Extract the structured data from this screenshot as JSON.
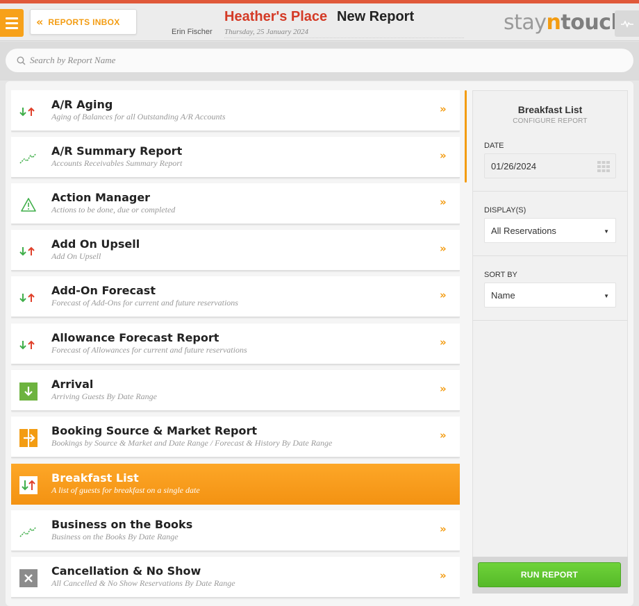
{
  "header": {
    "inbox_label": "REPORTS INBOX",
    "hotel_name": "Heather's Place",
    "page_title": "New Report",
    "user_name": "Erin Fischer",
    "date": "Thursday, 25 January 2024",
    "logo": {
      "stay": "stay",
      "n": "n",
      "touch": "touch"
    }
  },
  "search": {
    "placeholder": "Search by Report Name"
  },
  "reports": [
    {
      "title": "A/R Aging",
      "subtitle": "Aging of Balances for all Outstanding A/R Accounts",
      "icon": "arrows-down-up-icon"
    },
    {
      "title": "A/R Summary Report",
      "subtitle": "Accounts Receivables Summary Report",
      "icon": "trend-icon"
    },
    {
      "title": "Action Manager",
      "subtitle": "Actions to be done, due or completed",
      "icon": "warning-icon"
    },
    {
      "title": "Add On Upsell",
      "subtitle": "Add On Upsell",
      "icon": "arrows-down-up-icon"
    },
    {
      "title": "Add-On Forecast",
      "subtitle": "Forecast of Add-Ons for current and future reservations",
      "icon": "arrows-down-up-icon"
    },
    {
      "title": "Allowance Forecast Report",
      "subtitle": "Forecast of Allowances for current and future reservations",
      "icon": "arrows-down-up-icon"
    },
    {
      "title": "Arrival",
      "subtitle": "Arriving Guests By Date Range",
      "icon": "arrival-icon"
    },
    {
      "title": "Booking Source & Market Report",
      "subtitle": "Bookings by Source & Market and Date Range / Forecast & History By Date Range",
      "icon": "booking-source-icon"
    },
    {
      "title": "Breakfast List",
      "subtitle": "A list of guests for breakfast on a single date",
      "icon": "arrows-down-up-icon",
      "active": true
    },
    {
      "title": "Business on the Books",
      "subtitle": "Business on the Books By Date Range",
      "icon": "trend-icon"
    },
    {
      "title": "Cancellation & No Show",
      "subtitle": "All Cancelled & No Show Reservations By Date Range",
      "icon": "cancel-icon"
    }
  ],
  "config": {
    "title": "Breakfast List",
    "subtitle": "CONFIGURE REPORT",
    "date_label": "DATE",
    "date_value": "01/26/2024",
    "display_label": "DISPLAY(S)",
    "display_value": "All Reservations",
    "sort_label": "SORT BY",
    "sort_value": "Name",
    "run_label": "RUN REPORT"
  },
  "colors": {
    "accent": "#f39c12",
    "brand_red": "#d43a26",
    "run_green": "#5fc530",
    "arrow_down_green": "#3fae49",
    "arrow_up_red": "#e0402a"
  }
}
